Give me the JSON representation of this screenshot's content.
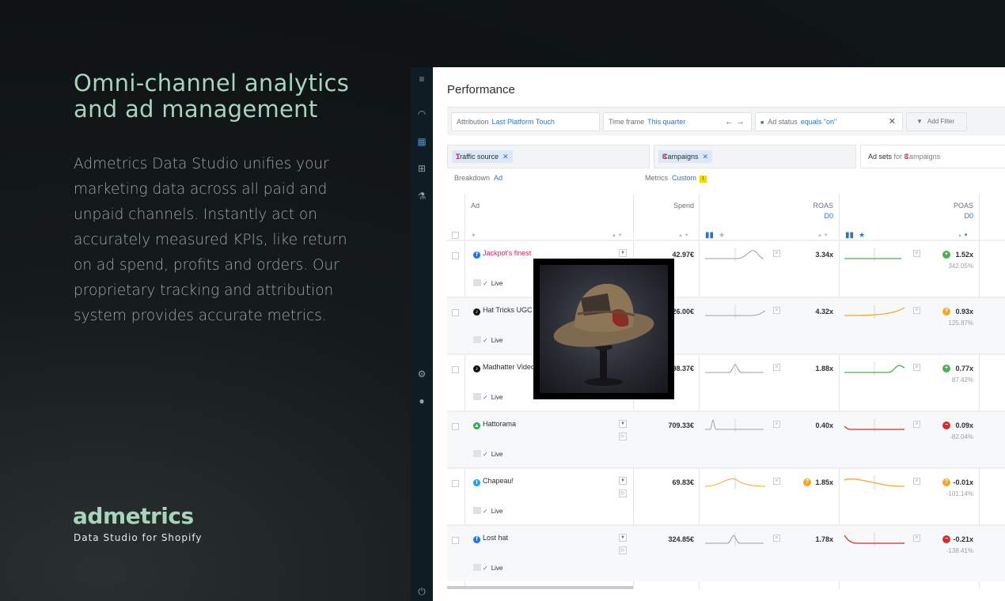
{
  "hero": {
    "title": "Omni-channel analytics and ad management",
    "body": "Admetrics Data Studio unifies your marketing data across all paid and unpaid channels. Instantly act on accurately measured KPIs, like return on ad spend, profits and orders. Our proprietary tracking and attribution system provides accurate metrics."
  },
  "brand": {
    "name": "admetrics",
    "tagline": "Data Studio for Shopify"
  },
  "app": {
    "page_title": "Performance",
    "filters": {
      "attribution_label": "Attribution",
      "attribution_value": "Last Platform Touch",
      "timeframe_label": "Time frame",
      "timeframe_value": "This quarter",
      "adstatus_label": "Ad status",
      "adstatus_value": "equals \"on\"",
      "add_filter": "Add Filter"
    },
    "chips": {
      "traffic_num": "1",
      "traffic_label": "Traffic source",
      "campaigns_num": "3",
      "campaigns_label": "Campaigns",
      "adsets_prefix": "Ad sets",
      "adsets_for": "for",
      "adsets_num": "3",
      "adsets_suffix": "Campaigns"
    },
    "breakdown_label": "Breakdown",
    "breakdown_value": "Ad",
    "metrics_label": "Metrics",
    "metrics_value": "Custom",
    "columns": {
      "ad": "Ad",
      "spend": "Spend",
      "roas": "ROAS",
      "roas_sub": "D0",
      "poas": "POAS",
      "poas_sub": "D0"
    },
    "live_label": "Live",
    "rows": [
      {
        "name": "Jackpot's finest",
        "channel": "facebook",
        "spend": "42.97€",
        "roas": "3.34x",
        "poas": "1.52x",
        "poas_pct": "342.05%",
        "poas_status": "good"
      },
      {
        "name": "Hat Tricks UGC",
        "channel": "tiktok",
        "spend": "26.00€",
        "roas": "4.32x",
        "poas": "0.93x",
        "poas_pct": "125.87%",
        "poas_status": "warn"
      },
      {
        "name": "Madhatter Video",
        "channel": "tiktok",
        "spend": "98.37€",
        "roas": "1.88x",
        "poas": "0.77x",
        "poas_pct": "87.42%",
        "poas_status": "good"
      },
      {
        "name": "Hattorama",
        "channel": "google",
        "spend": "709.33€",
        "roas": "0.40x",
        "poas": "0.09x",
        "poas_pct": "-82.04%",
        "poas_status": "bad"
      },
      {
        "name": "Chapeau!",
        "channel": "twitter",
        "spend": "69.83€",
        "roas": "1.85x",
        "poas": "-0.01x",
        "poas_pct": "-101.14%",
        "poas_status": "warn"
      },
      {
        "name": "Lost hat",
        "channel": "facebook",
        "spend": "324.85€",
        "roas": "1.78x",
        "poas": "-0.21x",
        "poas_pct": "-138.41%",
        "poas_status": "bad"
      }
    ]
  },
  "colors": {
    "accent": "#a7d4bc",
    "link": "#2f74c0",
    "good": "#4caf50",
    "warn": "#f5a623",
    "bad": "#d32f2f"
  }
}
